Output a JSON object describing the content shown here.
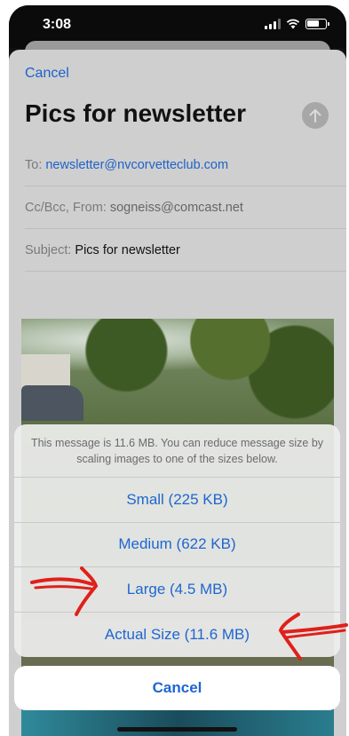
{
  "status_bar": {
    "time": "3:08"
  },
  "compose": {
    "cancel_label": "Cancel",
    "title": "Pics for newsletter",
    "to_label": "To:",
    "to_value": "newsletter@nvcorvetteclub.com",
    "ccbcc_label": "Cc/Bcc, From:",
    "from_value": "sogneiss@comcast.net",
    "subject_label": "Subject:",
    "subject_value": "Pics for newsletter"
  },
  "action_sheet": {
    "message": "This message is 11.6 MB. You can reduce message size by scaling images to one of the sizes below.",
    "options": [
      {
        "label": "Small (225 KB)"
      },
      {
        "label": "Medium (622 KB)"
      },
      {
        "label": "Large (4.5 MB)"
      },
      {
        "label": "Actual Size (11.6 MB)"
      }
    ],
    "cancel_label": "Cancel"
  },
  "colors": {
    "accent": "#1e66d0",
    "annotation": "#e0201a"
  },
  "icons": {
    "send": "arrow-up-icon",
    "signal": "signal-icon",
    "wifi": "wifi-icon",
    "battery": "battery-icon"
  }
}
